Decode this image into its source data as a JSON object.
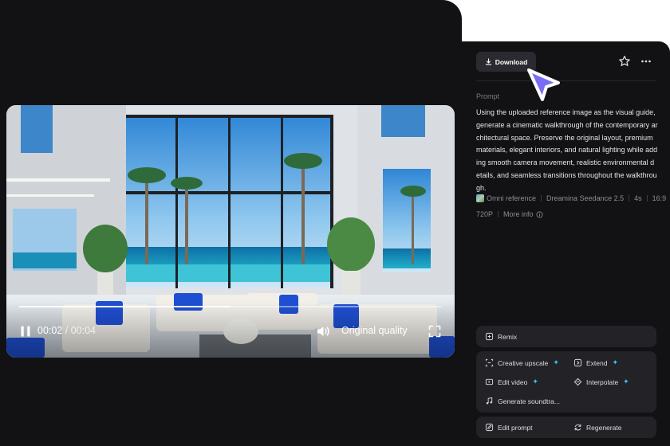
{
  "video": {
    "current_time": "00:02",
    "separator": " / ",
    "total_time": "00:04",
    "progress": 0.5,
    "quality_label": "Original quality"
  },
  "header": {
    "download_label": "Download"
  },
  "prompt": {
    "heading": "Prompt",
    "text": "Using the uploaded reference image as the visual guide, generate a cinematic walkthrough of the contemporary architectural space. Preserve the original layout, premium materials, elegant interiors, and natural lighting while adding smooth camera movement, realistic environmental details, and seamless transitions throughout the walkthrough."
  },
  "meta": {
    "reference": "Omni reference",
    "model": "Dreamina Seedance 2.5",
    "duration": "4s",
    "ratio": "16:9",
    "resolution": "720P",
    "more_info": "More info"
  },
  "actions": {
    "remix": "Remix",
    "creative_upscale": "Creative upscale",
    "extend": "Extend",
    "edit_video": "Edit video",
    "interpolate": "Interpolate",
    "generate_soundtrack": "Generate soundtra...",
    "edit_prompt": "Edit prompt",
    "regenerate": "Regenerate",
    "sparkle": "✦"
  },
  "colors": {
    "panel_bg": "#121215",
    "card_bg": "#222227",
    "accent_cyan": "#36c7ff",
    "cursor_fill": "#7b6cf6"
  }
}
